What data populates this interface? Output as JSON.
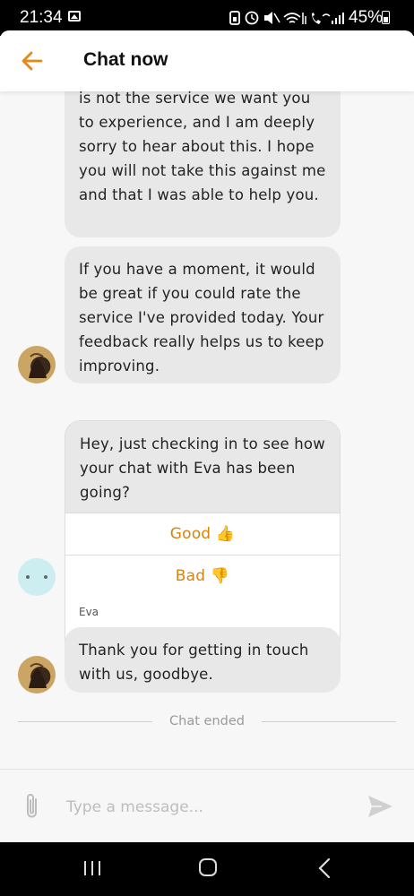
{
  "status_bar": {
    "time": "21:34",
    "battery": "45%",
    "icons": [
      "image-icon",
      "battery-saver-icon",
      "alarm-icon",
      "mute-icon",
      "wifi-icon",
      "signal-icon",
      "wifi-call-icon",
      "signal-bars-icon",
      "battery-icon"
    ]
  },
  "header": {
    "title": "Chat now",
    "back_icon": "arrow-left-icon",
    "accent_color": "#e8861a"
  },
  "messages": [
    {
      "sender": "agent",
      "text": "is not the service we want you to experience, and I am deeply sorry to hear about this. I hope you will not take this against me and that I was able to help you."
    },
    {
      "sender": "agent",
      "text": "If you have a moment, it would be great if you could rate the service I've provided today. Your feedback really helps us to keep improving."
    },
    {
      "sender": "bot",
      "text": "Hey, just checking in to see how your chat with Eva has been going?",
      "options": [
        "Good 👍",
        "Bad 👎"
      ],
      "sender_name": "Eva"
    },
    {
      "sender": "agent",
      "text": "Thank you for getting in touch with us, goodbye."
    }
  ],
  "chat_ended_label": "Chat ended",
  "composer": {
    "placeholder": "Type a message..."
  },
  "colors": {
    "bubble": "#e8e8e8",
    "option_text": "#d8830f",
    "bot_avatar": "#cdeef0"
  }
}
